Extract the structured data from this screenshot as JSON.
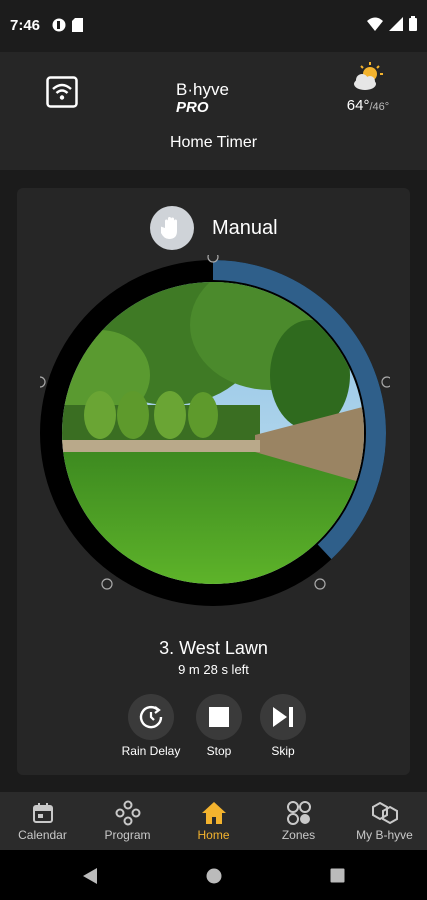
{
  "status_bar": {
    "time": "7:46"
  },
  "header": {
    "title": "Home Timer",
    "logo_text": "B·hyve",
    "logo_sub": "PRO",
    "temp_high": "64°",
    "temp_low": "/46°"
  },
  "mode": {
    "label": "Manual"
  },
  "current_zone": {
    "name": "3. West Lawn",
    "time_left": "9 m 28 s left",
    "progress_fraction": 0.38
  },
  "controls": {
    "rain_delay": "Rain Delay",
    "stop": "Stop",
    "skip": "Skip"
  },
  "nav": {
    "items": [
      {
        "label": "Calendar",
        "icon": "calendar-icon"
      },
      {
        "label": "Program",
        "icon": "program-icon"
      },
      {
        "label": "Home",
        "icon": "home-icon"
      },
      {
        "label": "Zones",
        "icon": "zones-icon"
      },
      {
        "label": "My B-hyve",
        "icon": "my-bhyve-icon"
      }
    ],
    "active": "Home"
  },
  "colors": {
    "accent": "#f3b32e",
    "progress": "#2f5f8a",
    "card": "#262626"
  }
}
